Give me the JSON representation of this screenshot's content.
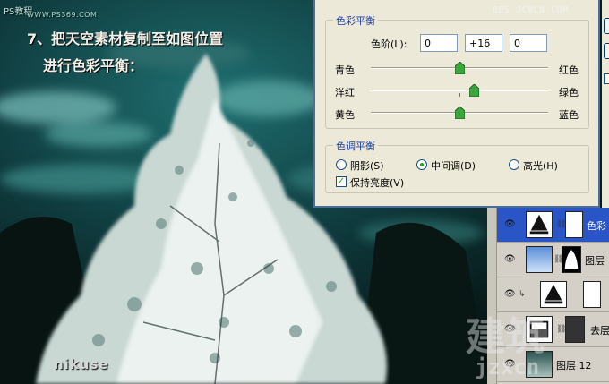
{
  "watermarks": {
    "top_left_brand": "PS教程",
    "top_left_url": "WWW.PS369.COM",
    "top_right_url": "BBS.JCWCN.COM",
    "bottom_left_logo": "nikuse",
    "bottom_right_big": "建筑",
    "bottom_right_sub": "jzxcn"
  },
  "caption": {
    "line1": "7、把天空素材复制至如图位置",
    "line2": "进行色彩平衡："
  },
  "dialog": {
    "color_balance_group": "色彩平衡",
    "levels_label": "色阶(L):",
    "levels_values": [
      "0",
      "+16",
      "0"
    ],
    "sliders": [
      {
        "left": "青色",
        "right": "红色",
        "value": 0
      },
      {
        "left": "洋红",
        "right": "绿色",
        "value": 16
      },
      {
        "left": "黄色",
        "right": "蓝色",
        "value": 0
      }
    ],
    "tone_group": "色调平衡",
    "tone_options": [
      {
        "label": "阴影(S)",
        "selected": false
      },
      {
        "label": "中间调(D)",
        "selected": true
      },
      {
        "label": "高光(H)",
        "selected": false
      }
    ],
    "preserve_luminosity": {
      "label": "保持亮度(V)",
      "checked": true
    }
  },
  "layers": [
    {
      "name": "色彩",
      "selected": true,
      "kind": "adjustment"
    },
    {
      "name": "图层",
      "selected": false,
      "kind": "sky"
    },
    {
      "name": "",
      "selected": false,
      "kind": "adjustment-clipped"
    },
    {
      "name": "去层",
      "selected": false,
      "kind": "adjustment"
    },
    {
      "name": "图层 12",
      "selected": false,
      "kind": "tree"
    }
  ],
  "colors": {
    "dialog_bg": "#ece9d8",
    "group_title": "#1b3ea8",
    "selected_layer": "#2a55c7",
    "radio_dot": "#21a121"
  }
}
